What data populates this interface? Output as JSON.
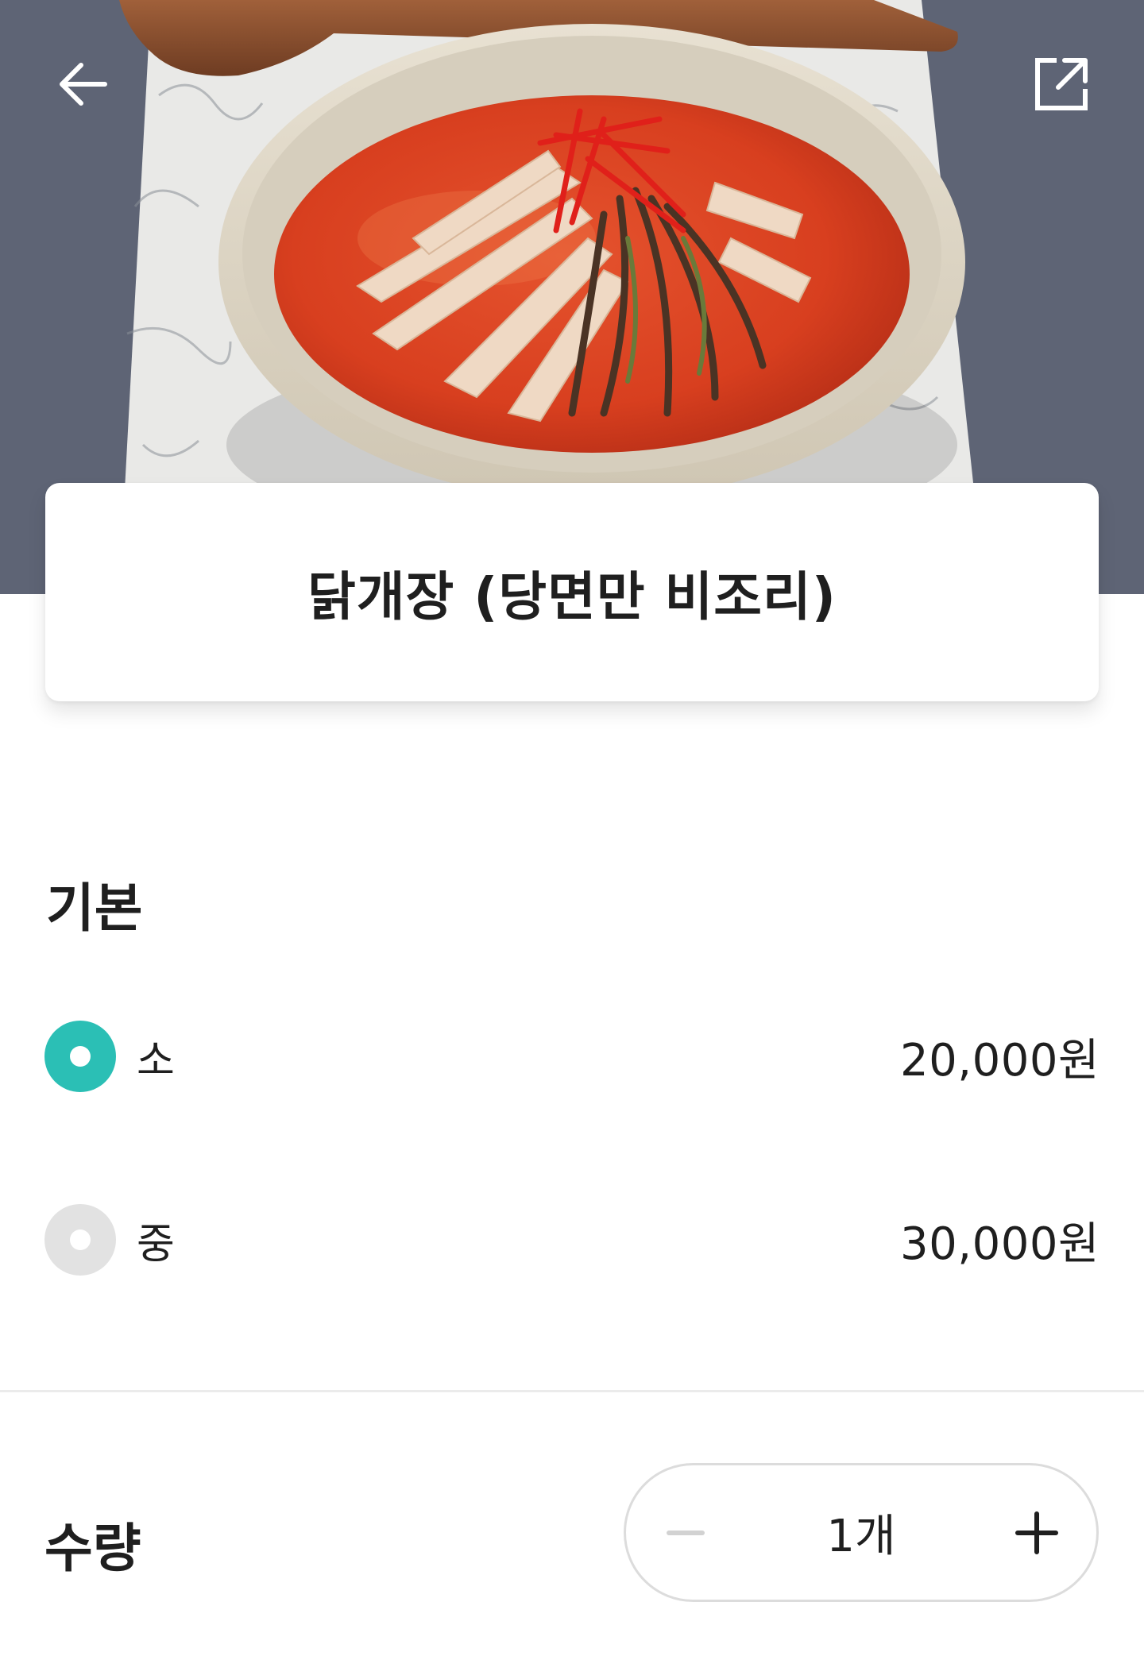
{
  "header": {
    "back_icon": "arrow-left-icon",
    "share_icon": "share-external-icon"
  },
  "product": {
    "title": "닭개장 (당면만 비조리)"
  },
  "options": {
    "section_title": "기본",
    "items": [
      {
        "label": "소",
        "price": "20,000원",
        "selected": true
      },
      {
        "label": "중",
        "price": "30,000원",
        "selected": false
      }
    ]
  },
  "quantity": {
    "label": "수량",
    "value": "1개",
    "minus_icon": "minus-icon",
    "plus_icon": "plus-icon"
  },
  "colors": {
    "accent": "#2bbfb5",
    "radio_inactive": "#e2e2e2",
    "text": "#1f1f1f"
  }
}
